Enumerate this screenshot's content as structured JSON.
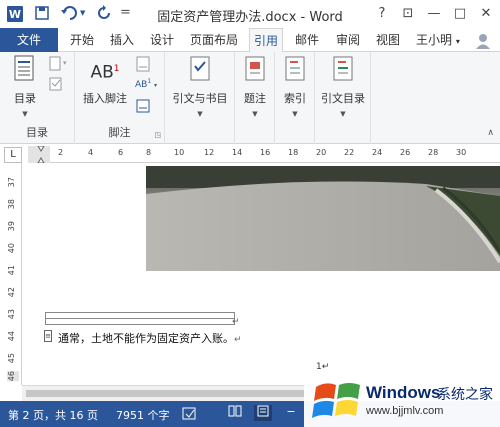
{
  "window": {
    "title": "固定资产管理办法.docx - Word",
    "help": "?",
    "ribbon_display": "⊡",
    "minimize": "—",
    "maximize": "□",
    "close": "✕"
  },
  "quick_access": {
    "app_icon": "word-icon",
    "save_icon": "save-icon",
    "undo_icon": "undo-icon",
    "redo_icon": "redo-icon",
    "customize": "="
  },
  "tabs": {
    "file": "文件",
    "items": [
      "开始",
      "插入",
      "设计",
      "页面布局",
      "引用",
      "邮件",
      "审阅",
      "视图"
    ],
    "active": "引用",
    "user": "王小明"
  },
  "ribbon": {
    "groups": [
      {
        "label": "目录",
        "buttons": [
          "目录"
        ]
      },
      {
        "label": "脚注",
        "buttons": [
          "插入脚注"
        ]
      },
      {
        "label": "",
        "buttons": [
          "引文与书目"
        ]
      },
      {
        "label": "",
        "buttons": [
          "题注"
        ]
      },
      {
        "label": "",
        "buttons": [
          "索引"
        ]
      },
      {
        "label": "",
        "buttons": [
          "引文目录"
        ]
      }
    ],
    "ab_mark": "AB",
    "ab_sup": "1",
    "ab_small": "AB"
  },
  "ruler": {
    "corner": "L",
    "h_ticks": [
      "2",
      "4",
      "6",
      "8",
      "10",
      "12",
      "14",
      "16",
      "18",
      "20",
      "22",
      "24",
      "26",
      "28",
      "30"
    ],
    "v_ticks": [
      "37",
      "38",
      "39",
      "40",
      "41",
      "42",
      "43",
      "44",
      "45",
      "46"
    ]
  },
  "document": {
    "body_text": "通常，土地不能作为固定资产入账。",
    "paragraph_mark": "↵",
    "page_number": "1"
  },
  "status": {
    "page": "第 2 页，共 16 页",
    "words": "7951 个字",
    "zoom_minus": "−"
  },
  "watermark": {
    "name": "Windows",
    "cn": "系统之家",
    "url": "www.bjjmlv.com"
  },
  "colors": {
    "accent": "#2b579a",
    "ribbon_bg": "#f5f6f7"
  }
}
